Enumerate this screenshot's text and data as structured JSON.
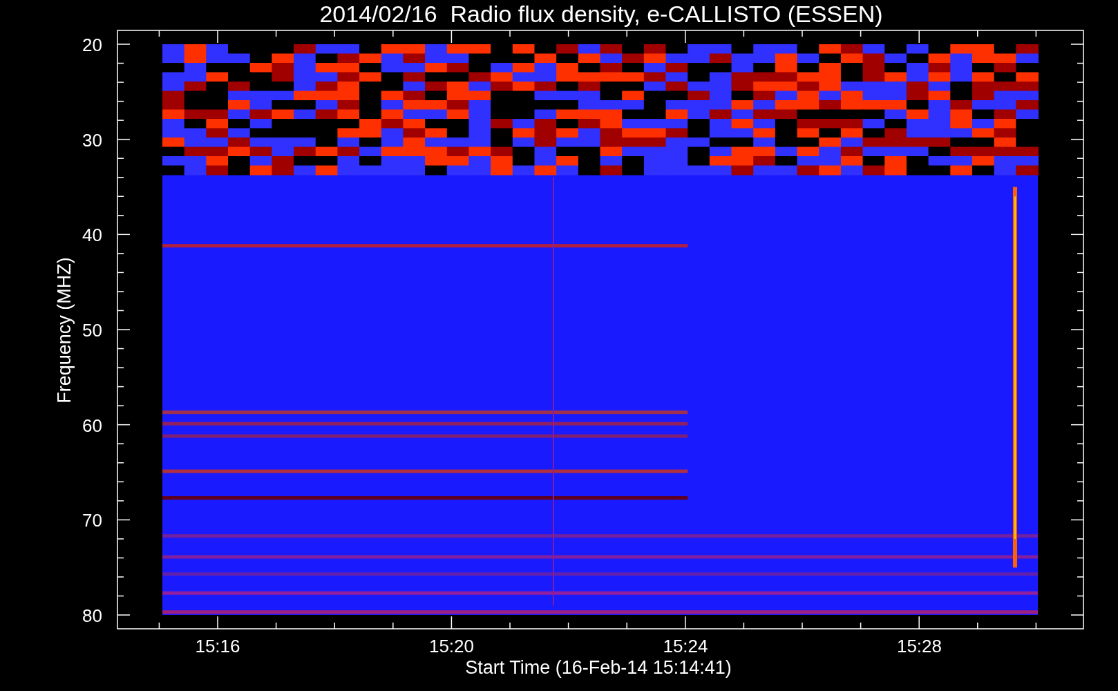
{
  "title": "2014/02/16  Radio flux density, e-CALLISTO (ESSEN)",
  "axes": {
    "ylabel": "Frequency (MHZ)",
    "xlabel": "Start Time (16-Feb-14 15:14:41)",
    "yticks": [
      "20",
      "30",
      "40",
      "50",
      "60",
      "70",
      "80"
    ],
    "xticks": [
      "15:16",
      "15:20",
      "15:24",
      "15:28"
    ]
  }
}
